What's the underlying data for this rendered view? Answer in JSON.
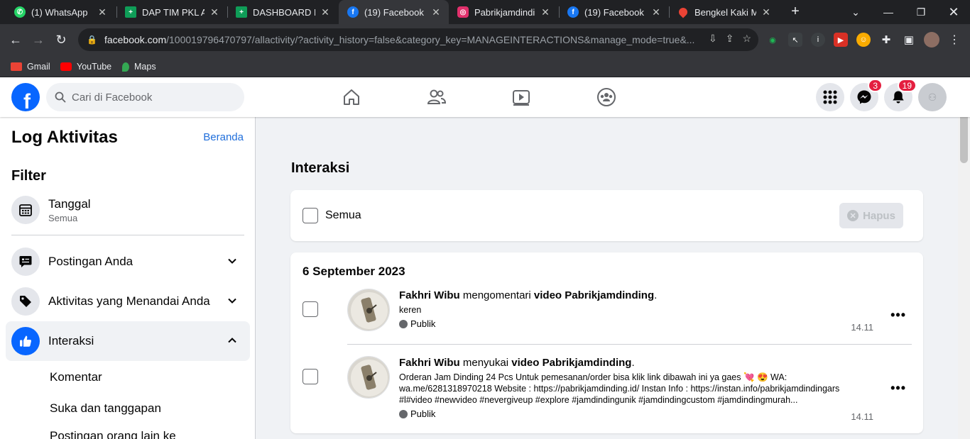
{
  "browser": {
    "tabs": [
      {
        "title": "(1) WhatsApp",
        "icon": "whatsapp-icon",
        "color": "#25d366"
      },
      {
        "title": "DAP TIM PKL Aru",
        "icon": "sheets-icon",
        "color": "#0f9d58"
      },
      {
        "title": "DASHBOARD RU",
        "icon": "sheets-icon",
        "color": "#0f9d58"
      },
      {
        "title": "(19) Facebook",
        "icon": "facebook-icon",
        "color": "#1877f2"
      },
      {
        "title": "Pabrikjamdinding",
        "icon": "instagram-icon",
        "color": "#e1306c"
      },
      {
        "title": "(19) Facebook",
        "icon": "facebook-icon",
        "color": "#1877f2"
      },
      {
        "title": "Bengkel Kaki Mol",
        "icon": "maps-icon",
        "color": "#ea4335"
      }
    ],
    "active_tab": 3,
    "url_host": "facebook.com",
    "url_path": "/100019796470797/allactivity/?activity_history=false&category_key=MANAGEINTERACTIONS&manage_mode=true&...",
    "bookmarks": [
      {
        "label": "Gmail",
        "icon": "gmail-icon"
      },
      {
        "label": "YouTube",
        "icon": "youtube-icon"
      },
      {
        "label": "Maps",
        "icon": "maps-icon"
      }
    ]
  },
  "fb": {
    "search_placeholder": "Cari di Facebook",
    "messenger_badge": "3",
    "notif_badge": "19",
    "brand_color": "#0866ff"
  },
  "sidebar": {
    "title": "Log Aktivitas",
    "home_link": "Beranda",
    "filter_heading": "Filter",
    "date_filter": {
      "label": "Tanggal",
      "value": "Semua"
    },
    "items": [
      {
        "label": "Postingan Anda",
        "icon": "post-icon"
      },
      {
        "label": "Aktivitas yang Menandai Anda",
        "icon": "tag-icon"
      },
      {
        "label": "Interaksi",
        "icon": "like-icon"
      }
    ],
    "subitems": [
      "Komentar",
      "Suka dan tanggapan",
      "Postingan orang lain ke"
    ]
  },
  "main": {
    "title": "Interaksi",
    "select_all_label": "Semua",
    "delete_label": "Hapus",
    "date_heading": "6 September 2023",
    "items": [
      {
        "actor": "Fakhri Wibu",
        "verb": " mengomentari ",
        "object": "video Pabrikjamdinding",
        "body": "keren",
        "privacy": "Publik",
        "time": "14.11"
      },
      {
        "actor": "Fakhri Wibu",
        "verb": " menyukai ",
        "object": "video Pabrikjamdinding",
        "body": "Orderan Jam Dinding 24 Pcs Untuk pemesanan/order bisa klik link dibawah ini ya gaes 💘 😍 WA: wa.me/6281318970218 Website : https://pabrikjamdinding.id/ Instan Info : https://instan.info/pabrikjamdindingars #l#video #newvideo #nevergiveup #explore #jamdindingunik #jamdindingcustom #jamdindingmurah...",
        "privacy": "Publik",
        "time": "14.11"
      }
    ]
  }
}
